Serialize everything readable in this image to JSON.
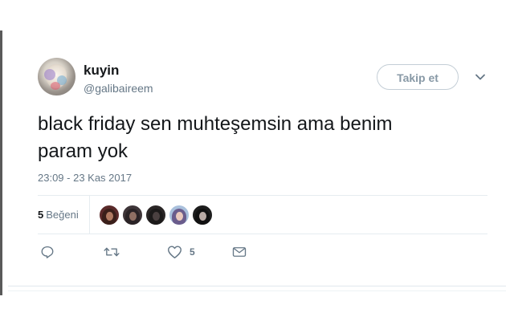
{
  "tweet": {
    "display_name": "kuyin",
    "screen_name": "@galibaireem",
    "follow_label": "Takip et",
    "text": "black friday sen muhteşemsin ama benim\nparam yok",
    "timestamp": "23:09 - 23 Kas 2017"
  },
  "stats": {
    "likes_count": "5",
    "likes_label": "Beğeni",
    "likers": [
      {
        "hair": "#3a1f1a",
        "skin": "#b07a62",
        "bg": "#5a2a2a"
      },
      {
        "hair": "#2a2326",
        "skin": "#8f6f63",
        "bg": "#3e3538"
      },
      {
        "hair": "#1c1a1a",
        "skin": "#4a4040",
        "bg": "#2a2626"
      },
      {
        "hair": "#6a5c8c",
        "skin": "#e9c8bd",
        "bg": "#a9c0dc"
      },
      {
        "hair": "#111111",
        "skin": "#b9aaa5",
        "bg": "#1d1d1d"
      }
    ]
  },
  "actions": {
    "reply_icon": "reply-icon",
    "retweet_icon": "retweet-icon",
    "like_icon": "heart-icon",
    "like_count": "5",
    "dm_icon": "envelope-icon"
  },
  "colors": {
    "primary_text": "#14171a",
    "secondary_text": "#657786",
    "border": "#e6ecf0",
    "button_border": "#c4ced6",
    "button_text": "#8899a6"
  }
}
